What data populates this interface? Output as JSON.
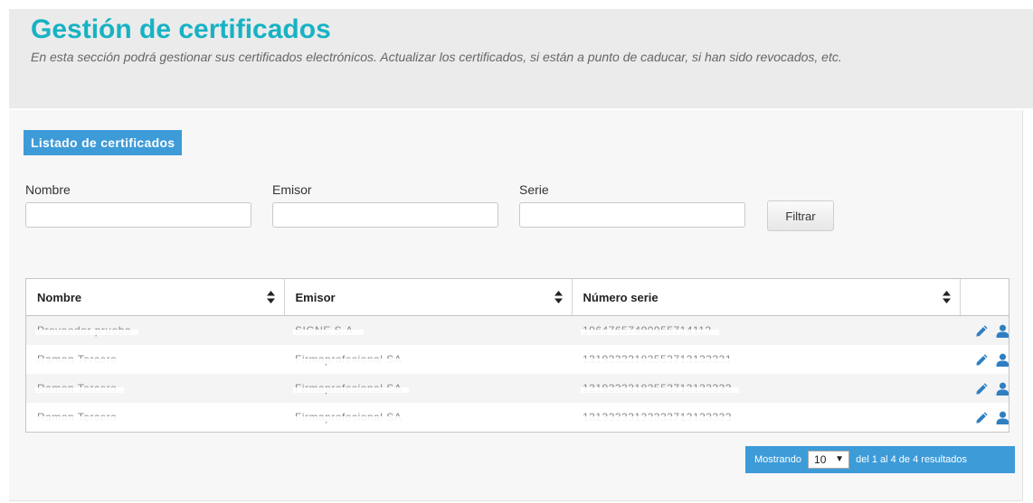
{
  "header": {
    "title": "Gestión de certificados",
    "description": "En esta sección podrá gestionar sus certificados electrónicos. Actualizar los certificados, si están a punto de caducar, si han sido revocados, etc."
  },
  "section": {
    "title": "Listado de certificados"
  },
  "filters": {
    "nombre_label": "Nombre",
    "nombre_value": "",
    "emisor_label": "Emisor",
    "emisor_value": "",
    "serie_label": "Serie",
    "serie_value": "",
    "button_label": "Filtrar"
  },
  "table": {
    "columns": [
      "Nombre",
      "Emisor",
      "Número serie"
    ],
    "rows": [
      {
        "nombre": "Proveedor prueba",
        "emisor": "SIGNE S.A.",
        "serie": "19647657490955714112"
      },
      {
        "nombre": "Ramon Tercero",
        "emisor": "Firmaprofesional SA",
        "serie": "13193333183553713133331"
      },
      {
        "nombre": "Ramon Tercero",
        "emisor": "Firmaprofesional SA",
        "serie": "13193333183553713133333"
      },
      {
        "nombre": "Ramon Tercero",
        "emisor": "Firmaprofesional SA",
        "serie": "13133333133333713133333"
      }
    ],
    "row_action_icons": [
      "pencil-icon",
      "user-icon"
    ]
  },
  "pagination": {
    "prefix": "Mostrando",
    "page_size": "10",
    "summary": "del 1 al 4 de 4 resultados"
  },
  "colors": {
    "title": "#17b2c4",
    "accent": "#3d9bd8",
    "header_bg": "#ebebeb"
  }
}
